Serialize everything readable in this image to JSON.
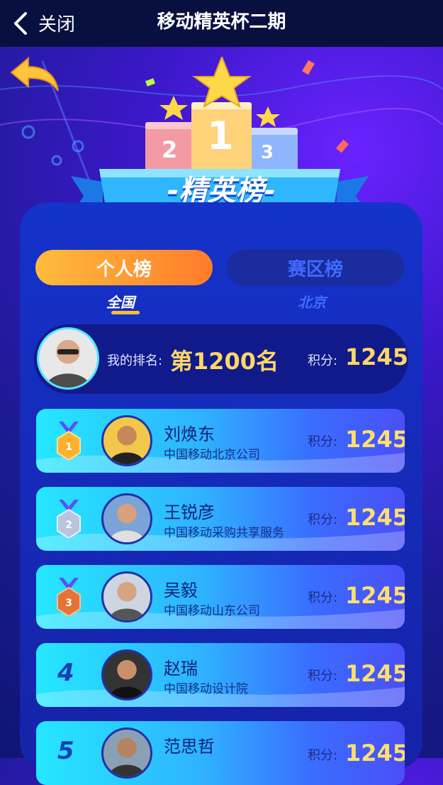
{
  "header": {
    "back_label": "关闭",
    "title": "移动精英杯二期"
  },
  "podium": {
    "first": "1",
    "second": "2",
    "third": "3"
  },
  "banner": {
    "text": "-精英榜-"
  },
  "tabs": [
    {
      "label": "个人榜",
      "active": true
    },
    {
      "label": "赛区榜",
      "active": false
    }
  ],
  "subtabs": [
    {
      "label": "全国",
      "active": true
    },
    {
      "label": "北京",
      "active": false
    }
  ],
  "my": {
    "label": "我的排名:",
    "rank": "第1200名",
    "score_label": "积分:",
    "score": "1245"
  },
  "rows": [
    {
      "rank": "1",
      "name": "刘焕东",
      "org": "中国移动北京公司",
      "score_label": "积分:",
      "score": "1245",
      "medal": "gold-medal-icon"
    },
    {
      "rank": "2",
      "name": "王锐彦",
      "org": "中国移动采购共享服务",
      "score_label": "积分:",
      "score": "1245",
      "medal": "silver-medal-icon"
    },
    {
      "rank": "3",
      "name": "吴毅",
      "org": "中国移动山东公司",
      "score_label": "积分:",
      "score": "1245",
      "medal": "bronze-medal-icon"
    },
    {
      "rank": "4",
      "name": "赵瑞",
      "org": "中国移动设计院",
      "score_label": "积分:",
      "score": "1245"
    },
    {
      "rank": "5",
      "name": "范思哲",
      "org": "",
      "score_label": "积分:",
      "score": "1245"
    }
  ],
  "colors": {
    "accent": "#ffbc3c",
    "score": "#ffdf6e",
    "panel": "#1532c9"
  }
}
